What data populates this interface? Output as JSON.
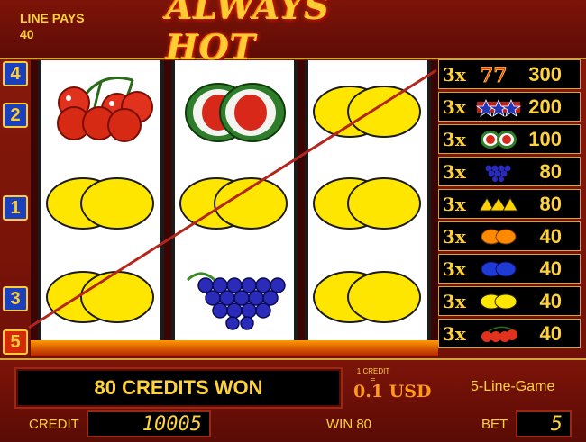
{
  "header": {
    "line_pays_label": "LINE PAYS",
    "line_pays_value": "40",
    "logo_text": "ALWAYS HOT"
  },
  "lines": [
    {
      "number": "4",
      "active": false
    },
    {
      "number": "2",
      "active": false
    },
    {
      "number": "1",
      "active": false
    },
    {
      "number": "3",
      "active": false
    },
    {
      "number": "5",
      "active": true
    }
  ],
  "reels": [
    [
      "cherries",
      "lemon",
      "lemon"
    ],
    [
      "melon",
      "lemon",
      "grapes"
    ],
    [
      "lemon",
      "lemon",
      "lemon"
    ]
  ],
  "paytable": [
    {
      "multiplier": "3x",
      "symbol": "sevens",
      "payout": "300"
    },
    {
      "multiplier": "3x",
      "symbol": "stars",
      "payout": "200"
    },
    {
      "multiplier": "3x",
      "symbol": "melons",
      "payout": "100"
    },
    {
      "multiplier": "3x",
      "symbol": "grapes",
      "payout": "80"
    },
    {
      "multiplier": "3x",
      "symbol": "bells",
      "payout": "80"
    },
    {
      "multiplier": "3x",
      "symbol": "oranges",
      "payout": "40"
    },
    {
      "multiplier": "3x",
      "symbol": "plums",
      "payout": "40"
    },
    {
      "multiplier": "3x",
      "symbol": "lemons",
      "payout": "40"
    },
    {
      "multiplier": "3x",
      "symbol": "cherries",
      "payout": "40"
    }
  ],
  "footer": {
    "message": "80 CREDITS WON",
    "credit_rate_label": "1 CREDIT =",
    "credit_rate_value": "0.1 USD",
    "game_name": "5-Line-Game",
    "credit_label": "CREDIT",
    "credit_value": "10005",
    "win_label": "WIN 80",
    "bet_label": "BET",
    "bet_value": "5"
  },
  "colors": {
    "accent": "#ffd23a",
    "frame": "#7a1208",
    "win_line": "#b3261e"
  }
}
